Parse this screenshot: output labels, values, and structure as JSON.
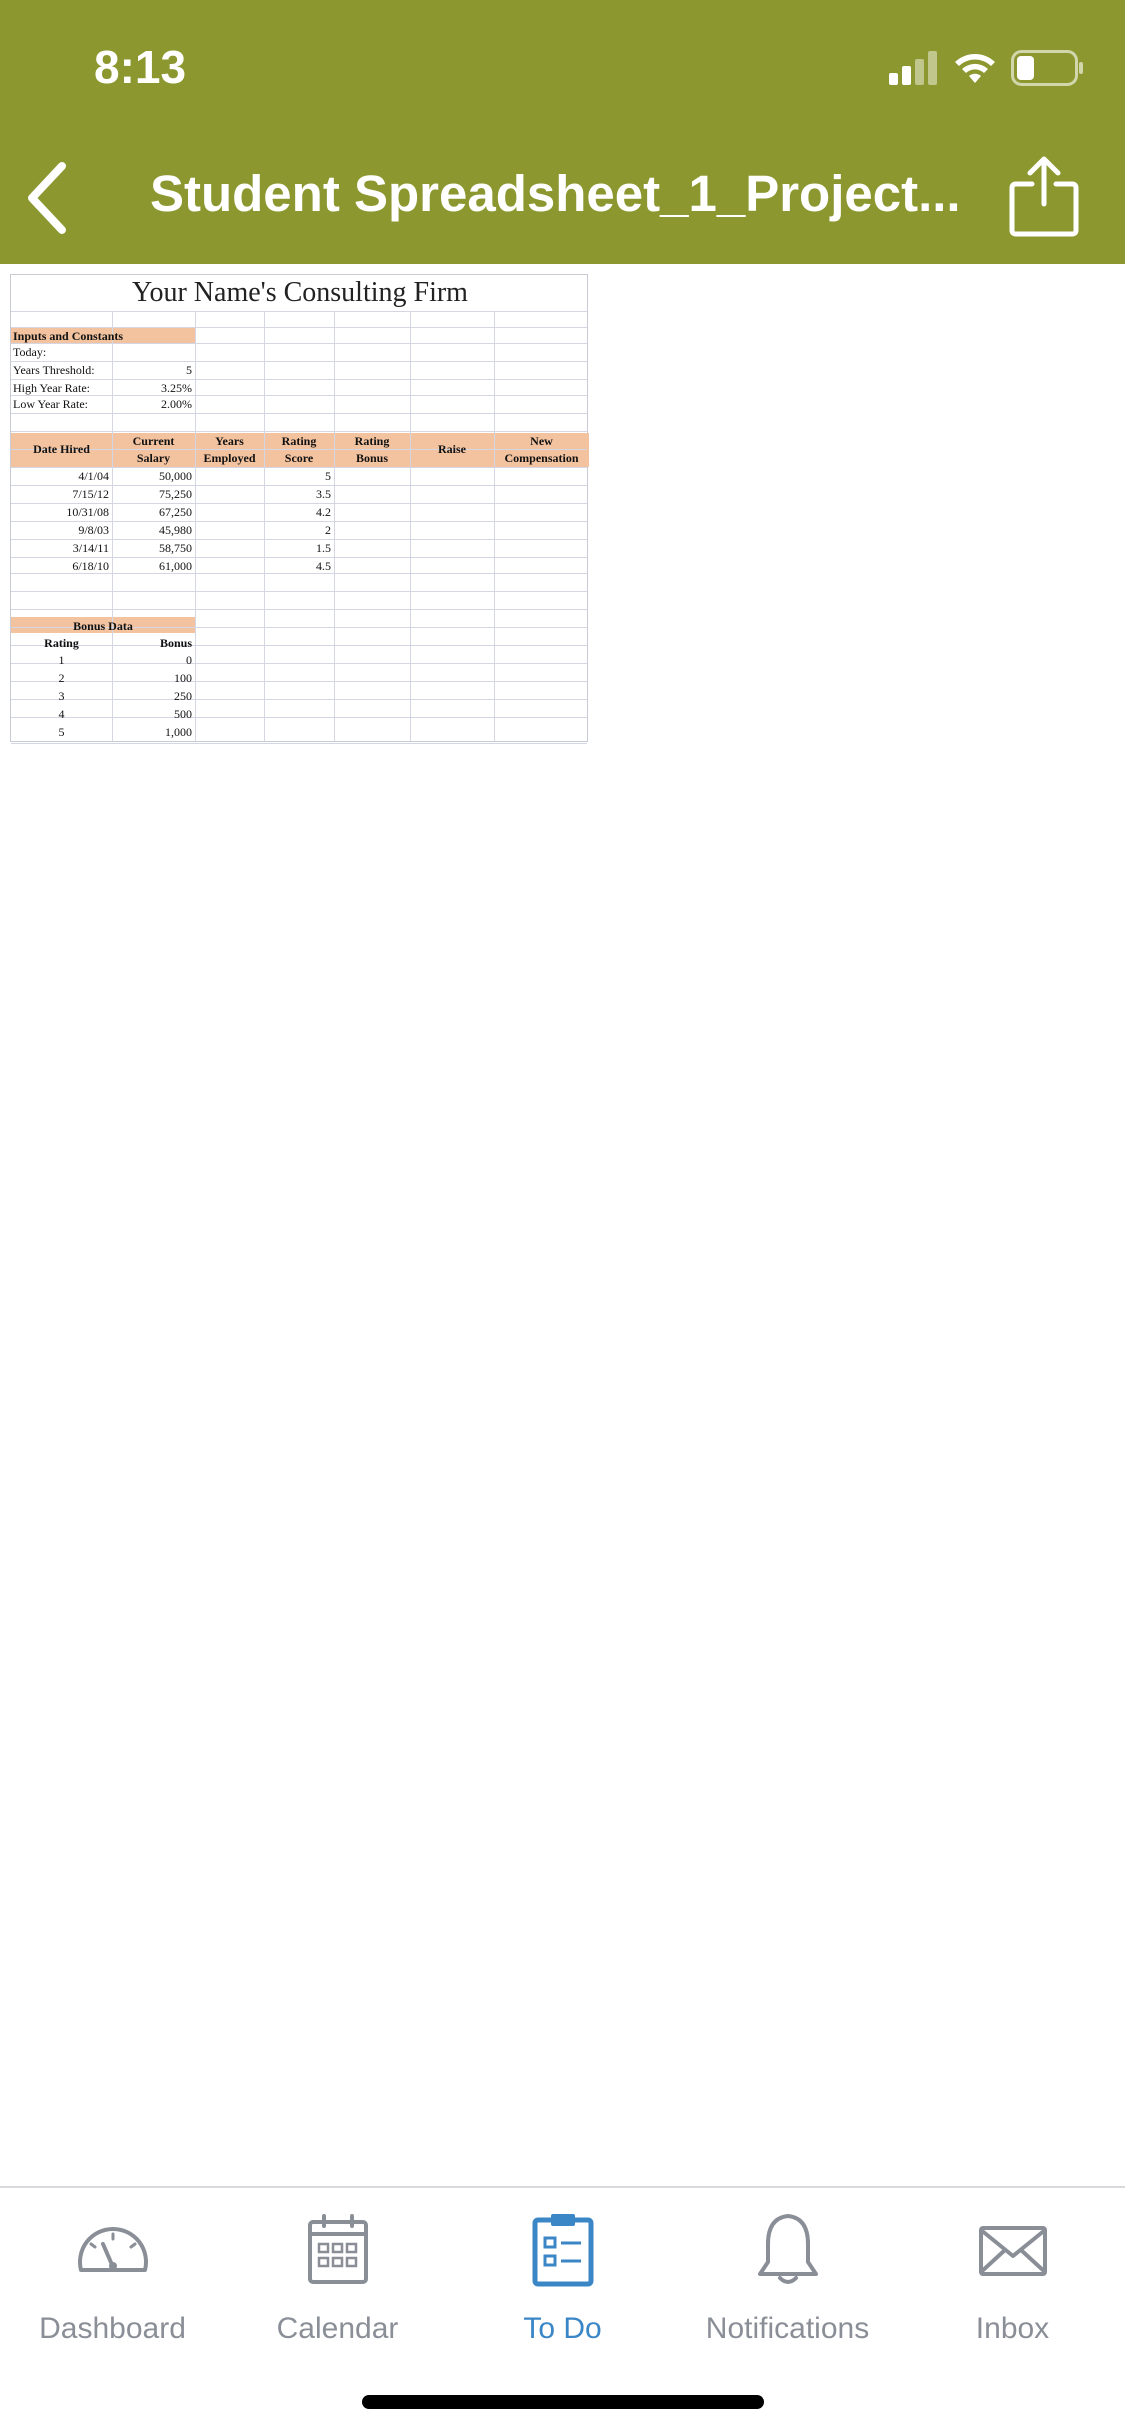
{
  "status_bar": {
    "time": "8:13"
  },
  "nav": {
    "title": "Student Spreadsheet_1_Project..."
  },
  "sheet": {
    "title": "Your Name's Consulting Firm",
    "inputs": {
      "header": "Inputs and Constants",
      "rows": [
        {
          "label": "Today:",
          "value": ""
        },
        {
          "label": "Years Threshold:",
          "value": "5"
        },
        {
          "label": "High Year Rate:",
          "value": "3.25%"
        },
        {
          "label": "Low Year Rate:",
          "value": "2.00%"
        }
      ]
    },
    "main_table": {
      "headers": [
        [
          "Date Hired"
        ],
        [
          "Current",
          "Salary"
        ],
        [
          "Years",
          "Employed"
        ],
        [
          "Rating",
          "Score"
        ],
        [
          "Rating",
          "Bonus"
        ],
        [
          "Raise"
        ],
        [
          "New",
          "Compensation"
        ]
      ],
      "rows": [
        {
          "date": "4/1/04",
          "salary": "50,000",
          "score": "5"
        },
        {
          "date": "7/15/12",
          "salary": "75,250",
          "score": "3.5"
        },
        {
          "date": "10/31/08",
          "salary": "67,250",
          "score": "4.2"
        },
        {
          "date": "9/8/03",
          "salary": "45,980",
          "score": "2"
        },
        {
          "date": "3/14/11",
          "salary": "58,750",
          "score": "1.5"
        },
        {
          "date": "6/18/10",
          "salary": "61,000",
          "score": "4.5"
        }
      ]
    },
    "bonus_table": {
      "header": "Bonus Data",
      "col_rating": "Rating",
      "col_bonus": "Bonus",
      "rows": [
        {
          "rating": "1",
          "bonus": "0"
        },
        {
          "rating": "2",
          "bonus": "100"
        },
        {
          "rating": "3",
          "bonus": "250"
        },
        {
          "rating": "4",
          "bonus": "500"
        },
        {
          "rating": "5",
          "bonus": "1,000"
        }
      ]
    }
  },
  "tabbar": {
    "tabs": [
      {
        "label": "Dashboard",
        "icon": "dashboard-gauge-icon",
        "active": false
      },
      {
        "label": "Calendar",
        "icon": "calendar-icon",
        "active": false
      },
      {
        "label": "To Do",
        "icon": "clipboard-checklist-icon",
        "active": true
      },
      {
        "label": "Notifications",
        "icon": "bell-icon",
        "active": false
      },
      {
        "label": "Inbox",
        "icon": "envelope-icon",
        "active": false
      }
    ],
    "colors": {
      "active": "#3b86c6",
      "inactive": "#8a8e96"
    }
  },
  "colors": {
    "header_bg": "#8c982f",
    "sheet_header_fill": "#f3c39f"
  }
}
